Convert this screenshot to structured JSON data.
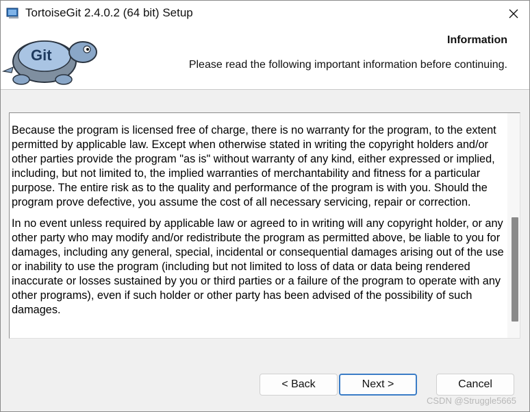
{
  "window": {
    "title": "TortoiseGit 2.4.0.2 (64 bit) Setup",
    "close_symbol": "✕"
  },
  "header": {
    "logo_text": "Git",
    "title": "Information",
    "subtitle": "Please read the following important information before continuing."
  },
  "info": {
    "paragraphs": [
      "Because the program is licensed free of charge, there is no warranty for the program, to the extent permitted by applicable law.  Except when otherwise stated in writing the copyright holders and/or other parties provide the program \"as is\" without warranty of any kind, either expressed or implied, including, but not limited to, the implied warranties of merchantability and fitness for a particular purpose.  The entire risk as to the quality and performance of the program is with you.  Should the program prove defective, you assume the cost of all necessary servicing, repair or correction.",
      "In no event unless required by applicable law or agreed to in writing will any copyright holder, or any other party who may modify and/or redistribute the program as permitted above, be liable to you for damages, including any general, special, incidental or consequential damages arising out of the use or inability to use the program (including but not limited to loss of data or data being rendered inaccurate or losses sustained by you or third parties or a failure of the program to operate with any other programs), even if such holder or other party has been advised of the possibility of such damages."
    ]
  },
  "buttons": {
    "back": "< Back",
    "next": "Next >",
    "cancel": "Cancel"
  },
  "watermark": "CSDN @Struggle5665",
  "colors": {
    "accent": "#3a7cc6",
    "window_bg": "#f0f0f0"
  },
  "icons": {
    "app": "installer-icon",
    "close": "close-icon",
    "logo": "tortoise-logo-icon"
  }
}
